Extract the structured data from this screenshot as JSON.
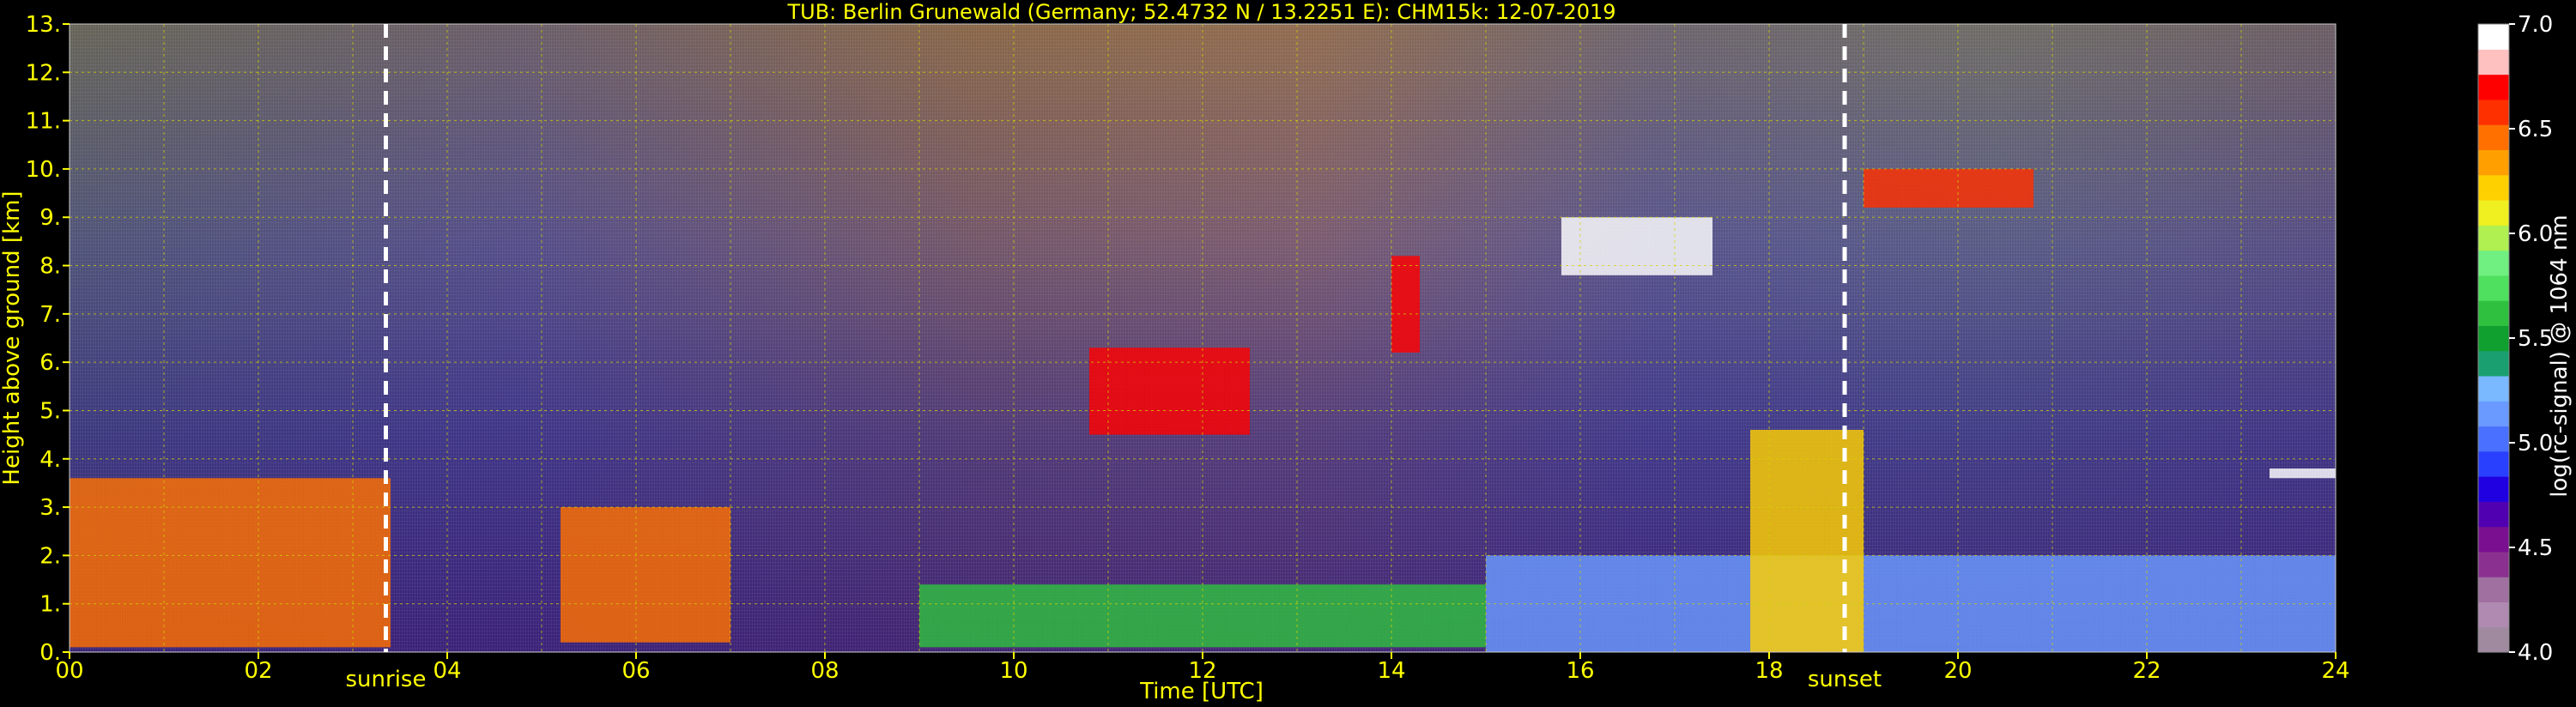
{
  "chart_data": {
    "type": "heatmap",
    "title": "TUB: Berlin Grunewald (Germany; 52.4732 N / 13.2251 E):    CHM15k: 12-07-2019",
    "xlabel": "Time [UTC]",
    "ylabel": "Height above ground [km]",
    "xlim": [
      0,
      24
    ],
    "ylim": [
      0,
      13
    ],
    "x_ticks": [
      "00",
      "02",
      "04",
      "06",
      "08",
      "10",
      "12",
      "14",
      "16",
      "18",
      "20",
      "22",
      "24"
    ],
    "y_ticks": [
      "0.",
      "1.",
      "2.",
      "3.",
      "4.",
      "5.",
      "6.",
      "7.",
      "8.",
      "9.",
      "10.",
      "11.",
      "12.",
      "13."
    ],
    "grid": true,
    "annotations": [
      {
        "label": "sunrise",
        "time": 3.35
      },
      {
        "label": "sunset",
        "time": 18.8
      }
    ],
    "colorbar": {
      "label": "log(rc-signal) @ 1064 nm",
      "range": [
        4.0,
        7.0
      ],
      "ticks": [
        "4.0",
        "4.5",
        "5.0",
        "5.5",
        "6.0",
        "6.5",
        "7.0"
      ],
      "colors": [
        "#a08aa0",
        "#b08ab0",
        "#a070a0",
        "#8a3090",
        "#7a1090",
        "#5000b0",
        "#2000e0",
        "#2a40ff",
        "#4a70ff",
        "#6a9aff",
        "#7ab8ff",
        "#1aa070",
        "#10a030",
        "#30c040",
        "#50e060",
        "#70f080",
        "#b0f050",
        "#f0f020",
        "#ffd000",
        "#ffa000",
        "#ff7000",
        "#ff3000",
        "#ff0000",
        "#ffc0c0",
        "#ffffff"
      ]
    },
    "cloud_layers": [
      {
        "start": 0.0,
        "end": 3.4,
        "bottom": 0.1,
        "top": 3.6,
        "level": 6.5
      },
      {
        "start": 5.2,
        "end": 7.0,
        "bottom": 0.2,
        "top": 3.0,
        "level": 6.5
      },
      {
        "start": 9.0,
        "end": 15.0,
        "bottom": 0.1,
        "top": 1.4,
        "level": 5.6
      },
      {
        "start": 10.8,
        "end": 12.5,
        "bottom": 4.5,
        "top": 6.3,
        "level": 6.8
      },
      {
        "start": 14.0,
        "end": 14.3,
        "bottom": 6.2,
        "top": 8.2,
        "level": 6.8
      },
      {
        "start": 15.8,
        "end": 17.4,
        "bottom": 7.8,
        "top": 9.0,
        "level": 7.0
      },
      {
        "start": 15.0,
        "end": 24.0,
        "bottom": 0.0,
        "top": 2.0,
        "level": 5.1
      },
      {
        "start": 17.8,
        "end": 19.0,
        "bottom": 0.0,
        "top": 4.6,
        "level": 6.3
      },
      {
        "start": 19.0,
        "end": 20.8,
        "bottom": 9.2,
        "top": 10.0,
        "level": 6.6
      },
      {
        "start": 23.3,
        "end": 24.0,
        "bottom": 3.6,
        "top": 3.8,
        "level": 7.0
      }
    ]
  }
}
